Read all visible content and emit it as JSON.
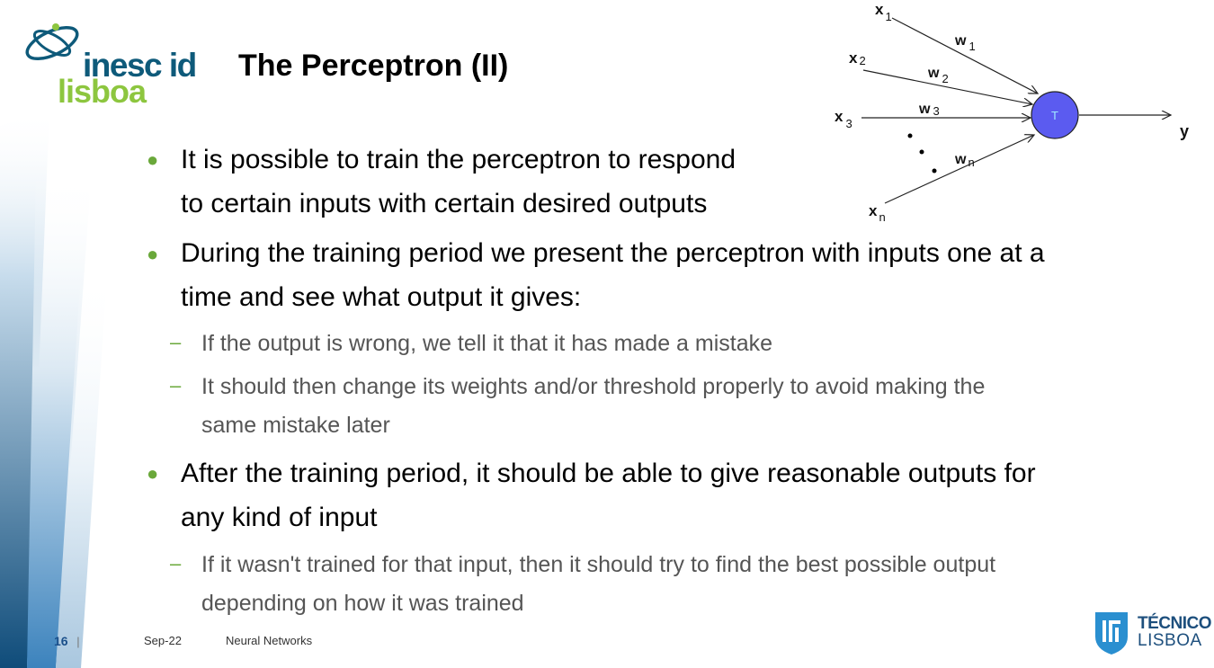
{
  "logo": {
    "line1": "inesc id",
    "line2": "lisboa"
  },
  "title": "The Perceptron (II)",
  "diagram": {
    "inputs": [
      "x",
      "x",
      "x",
      "x"
    ],
    "input_subscripts": [
      "1",
      "2",
      "3",
      "n"
    ],
    "weights": [
      "w",
      "w",
      "w",
      "w"
    ],
    "weight_subscripts": [
      "1",
      "2",
      "3",
      "n"
    ],
    "node_label": "T",
    "output_label": "y"
  },
  "bullets": [
    {
      "lines": [
        "It is possible to train the perceptron to respond",
        "to certain inputs with certain desired outputs"
      ]
    },
    {
      "lines": [
        "During the training period we present the perceptron with inputs one at a",
        "time and see what output it gives:"
      ],
      "sub": [
        {
          "lines": [
            "If the output is wrong, we tell it that it has made a mistake"
          ]
        },
        {
          "lines": [
            "It should then change its weights and/or threshold properly to avoid making the",
            "same mistake later"
          ]
        }
      ]
    },
    {
      "lines": [
        "After the training period, it should be able to give reasonable outputs for",
        "any kind of input"
      ],
      "sub": [
        {
          "lines": [
            "If it wasn't trained for that input, then it should try to find the best possible output",
            "depending on how it was trained"
          ]
        }
      ]
    }
  ],
  "footer": {
    "page": "16",
    "separator": "|",
    "date": "Sep-22",
    "topic": "Neural Networks"
  },
  "tecnico": {
    "line1": "TÉCNICO",
    "line2": "LISBOA"
  },
  "colors": {
    "bullet": "#6aa83a",
    "node_fill": "#5b5bf0",
    "stripe_dark": "#0e4f7d"
  }
}
